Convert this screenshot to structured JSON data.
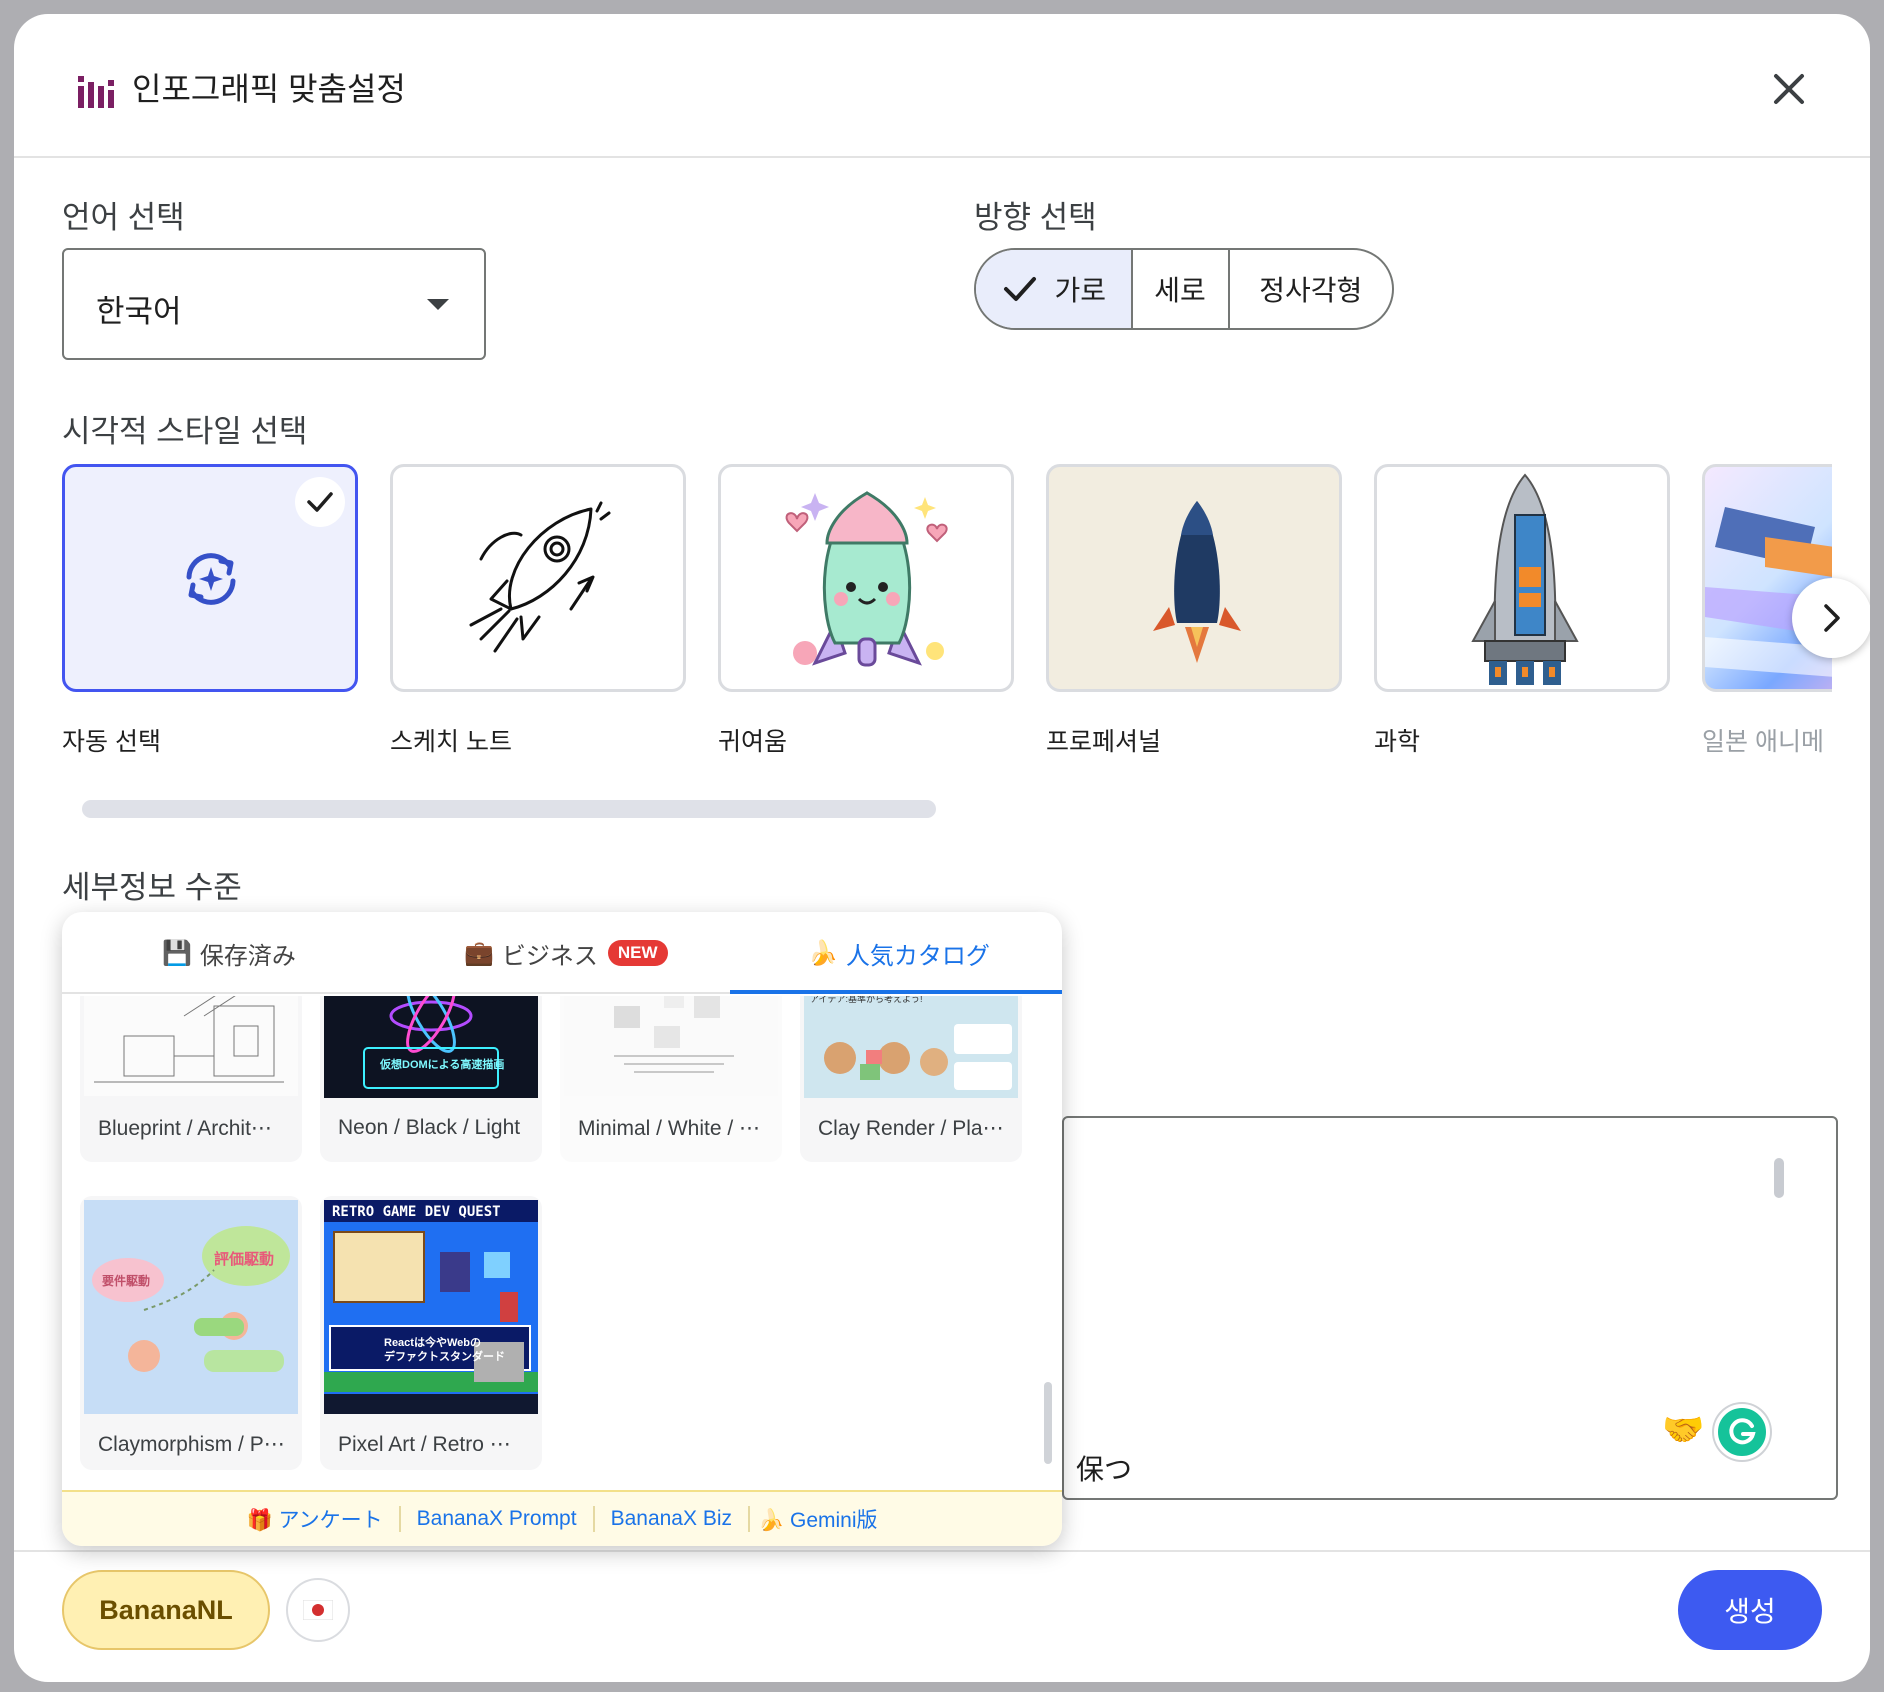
{
  "dialog": {
    "title": "인포그래픽 맞춤설정",
    "title_icon": "infographic-bars-icon",
    "close_icon": "close-icon"
  },
  "language": {
    "label": "언어 선택",
    "value": "한국어"
  },
  "orientation": {
    "label": "방향 선택",
    "options": [
      "가로",
      "세로",
      "정사각형"
    ],
    "selected": "가로"
  },
  "visual_style": {
    "label": "시각적 스타일 선택",
    "items": [
      {
        "label": "자동 선택",
        "selected": true,
        "icon": "auto-select-icon"
      },
      {
        "label": "스케치 노트",
        "icon": "sketch-rocket-icon"
      },
      {
        "label": "귀여움",
        "icon": "cute-rocket-icon"
      },
      {
        "label": "프로페셔널",
        "icon": "professional-rocket-icon"
      },
      {
        "label": "과학",
        "icon": "science-rocket-icon"
      },
      {
        "label": "일본 애니메",
        "icon": "anime-rocket-icon"
      }
    ],
    "next_icon": "chevron-right-icon"
  },
  "detail": {
    "label": "세부정보 수준",
    "peek_text": "保つ"
  },
  "popup": {
    "tabs": [
      {
        "emoji": "💾",
        "label": "保存済み"
      },
      {
        "emoji": "💼",
        "label": "ビジネス",
        "badge": "NEW"
      },
      {
        "emoji": "🍌",
        "label": "人気カタログ",
        "active": true
      }
    ],
    "tiles": [
      {
        "caption": "Blueprint / Archit⋯",
        "thumb": "blueprint-thumbnail"
      },
      {
        "caption": "Neon / Black / Light",
        "thumb": "neon-thumbnail",
        "thumb_text": "仮想DOMによる高速描画"
      },
      {
        "caption": "Minimal / White / ⋯",
        "thumb": "minimal-thumbnail"
      },
      {
        "caption": "Clay Render / Pla⋯",
        "thumb": "clay-render-thumbnail",
        "thumb_text": "アイデア:基準から考えよう!"
      },
      {
        "caption": "Claymorphism / P⋯",
        "thumb": "claymorphism-thumbnail",
        "thumb_text": [
          "要件駆動",
          "評価駆動"
        ]
      },
      {
        "caption": "Pixel Art / Retro ⋯",
        "thumb": "pixel-art-thumbnail",
        "thumb_text": [
          "RETRO GAME DEV QUEST",
          "Reactは今やWebの",
          "デファクトスタンダード"
        ]
      }
    ],
    "footer_links": [
      {
        "emoji": "🎁",
        "label": "アンケート"
      },
      {
        "label": "BananaX Prompt"
      },
      {
        "label": "BananaX Biz"
      },
      {
        "emoji": "🍌",
        "label": "Gemini版"
      }
    ]
  },
  "footer": {
    "brand_button": "BananaNL",
    "flag_icon": "japan-flag-icon",
    "generate_button": "생성"
  },
  "colors": {
    "accent": "#3d5af1",
    "selected_border": "#4355f0",
    "link": "#1a73e8",
    "brand_bg": "#fff0b3"
  }
}
